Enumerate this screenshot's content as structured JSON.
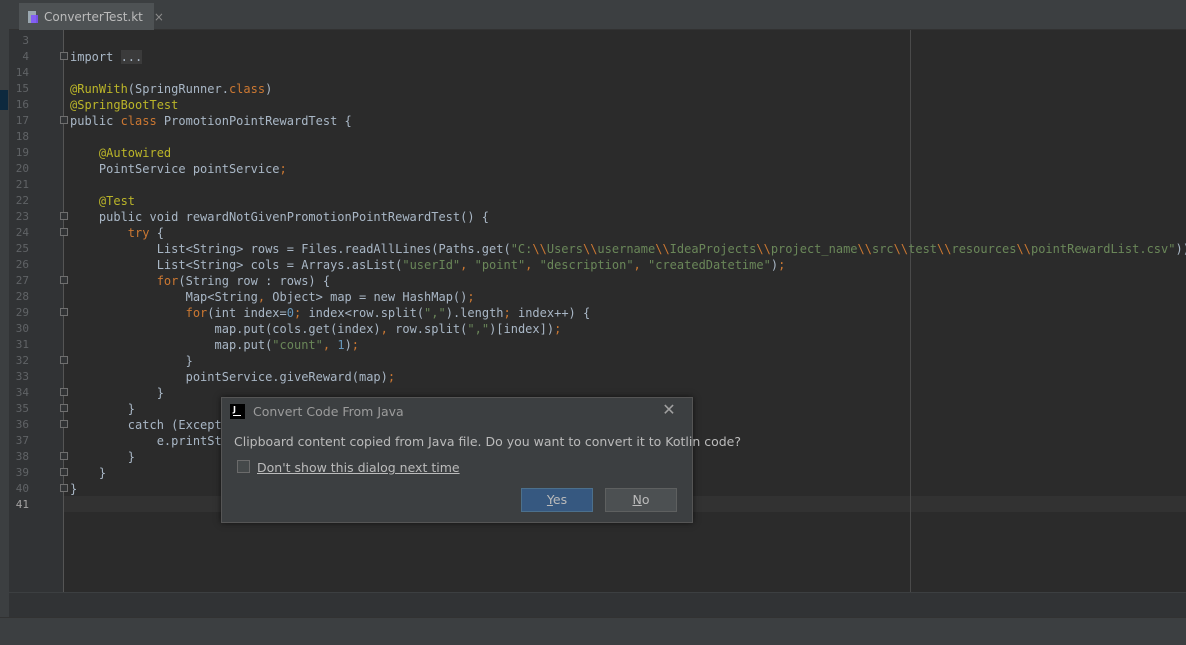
{
  "tab": {
    "filename": "ConverterTest.kt",
    "close": "×"
  },
  "editor": {
    "lines": [
      {
        "n": "3",
        "fold": false,
        "segs": []
      },
      {
        "n": "4",
        "fold": true,
        "segs": [
          [
            "plain",
            "import "
          ],
          [
            "foldbox",
            "..."
          ]
        ]
      },
      {
        "n": "14",
        "fold": false,
        "segs": []
      },
      {
        "n": "15",
        "fold": false,
        "segs": [
          [
            "ann",
            "@RunWith"
          ],
          [
            "plain",
            "(SpringRunner."
          ],
          [
            "kw",
            "class"
          ],
          [
            "plain",
            ")"
          ]
        ]
      },
      {
        "n": "16",
        "fold": false,
        "segs": [
          [
            "ann",
            "@SpringBootTest"
          ]
        ]
      },
      {
        "n": "17",
        "fold": true,
        "segs": [
          [
            "plain",
            "public "
          ],
          [
            "kw",
            "class"
          ],
          [
            "plain",
            " PromotionPointRewardTest {"
          ]
        ]
      },
      {
        "n": "18",
        "fold": false,
        "segs": []
      },
      {
        "n": "19",
        "fold": false,
        "segs": [
          [
            "plain",
            "    "
          ],
          [
            "ann",
            "@Autowired"
          ]
        ]
      },
      {
        "n": "20",
        "fold": false,
        "segs": [
          [
            "plain",
            "    PointService pointService"
          ],
          [
            "kw",
            ";"
          ]
        ]
      },
      {
        "n": "21",
        "fold": false,
        "segs": []
      },
      {
        "n": "22",
        "fold": false,
        "segs": [
          [
            "plain",
            "    "
          ],
          [
            "ann",
            "@Test"
          ]
        ]
      },
      {
        "n": "23",
        "fold": true,
        "segs": [
          [
            "plain",
            "    public void rewardNotGivenPromotionPointRewardTest() {"
          ]
        ]
      },
      {
        "n": "24",
        "fold": true,
        "segs": [
          [
            "plain",
            "        "
          ],
          [
            "kw",
            "try"
          ],
          [
            "plain",
            " {"
          ]
        ]
      },
      {
        "n": "25",
        "fold": false,
        "segs": [
          [
            "plain",
            "            List<String> rows = Files.readAllLines(Paths.get("
          ],
          [
            "str",
            "\"C:"
          ],
          [
            "esc",
            "\\\\"
          ],
          [
            "str",
            "Users"
          ],
          [
            "esc",
            "\\\\"
          ],
          [
            "str",
            "username"
          ],
          [
            "esc",
            "\\\\"
          ],
          [
            "str",
            "IdeaProjects"
          ],
          [
            "esc",
            "\\\\"
          ],
          [
            "str",
            "project_name"
          ],
          [
            "esc",
            "\\\\"
          ],
          [
            "str",
            "src"
          ],
          [
            "esc",
            "\\\\"
          ],
          [
            "str",
            "test"
          ],
          [
            "esc",
            "\\\\"
          ],
          [
            "str",
            "resources"
          ],
          [
            "esc",
            "\\\\"
          ],
          [
            "str",
            "pointRewardList.csv\""
          ],
          [
            "plain",
            "))"
          ],
          [
            "kw",
            ";"
          ]
        ]
      },
      {
        "n": "26",
        "fold": false,
        "segs": [
          [
            "plain",
            "            List<String> cols = Arrays.asList("
          ],
          [
            "str",
            "\"userId\""
          ],
          [
            "kw",
            ", "
          ],
          [
            "str",
            "\"point\""
          ],
          [
            "kw",
            ", "
          ],
          [
            "str",
            "\"description\""
          ],
          [
            "kw",
            ", "
          ],
          [
            "str",
            "\"createdDatetime\""
          ],
          [
            "plain",
            ")"
          ],
          [
            "kw",
            ";"
          ]
        ]
      },
      {
        "n": "27",
        "fold": true,
        "segs": [
          [
            "plain",
            "            "
          ],
          [
            "kw",
            "for"
          ],
          [
            "plain",
            "(String row : rows) {"
          ]
        ]
      },
      {
        "n": "28",
        "fold": false,
        "segs": [
          [
            "plain",
            "                Map<String"
          ],
          [
            "kw",
            ", "
          ],
          [
            "plain",
            "Object> map = new HashMap()"
          ],
          [
            "kw",
            ";"
          ]
        ]
      },
      {
        "n": "29",
        "fold": true,
        "segs": [
          [
            "plain",
            "                "
          ],
          [
            "kw",
            "for"
          ],
          [
            "plain",
            "(int index="
          ],
          [
            "num",
            "0"
          ],
          [
            "kw",
            "; "
          ],
          [
            "plain",
            "index<row.split("
          ],
          [
            "str",
            "\",\""
          ],
          [
            "plain",
            ").length"
          ],
          [
            "kw",
            "; "
          ],
          [
            "plain",
            "index++) {"
          ]
        ]
      },
      {
        "n": "30",
        "fold": false,
        "segs": [
          [
            "plain",
            "                    map.put(cols.get(index)"
          ],
          [
            "kw",
            ", "
          ],
          [
            "plain",
            "row.split("
          ],
          [
            "str",
            "\",\""
          ],
          [
            "plain",
            ")[index])"
          ],
          [
            "kw",
            ";"
          ]
        ]
      },
      {
        "n": "31",
        "fold": false,
        "segs": [
          [
            "plain",
            "                    map.put("
          ],
          [
            "str",
            "\"count\""
          ],
          [
            "kw",
            ", "
          ],
          [
            "num",
            "1"
          ],
          [
            "plain",
            ")"
          ],
          [
            "kw",
            ";"
          ]
        ]
      },
      {
        "n": "32",
        "fold": true,
        "segs": [
          [
            "plain",
            "                }"
          ]
        ]
      },
      {
        "n": "33",
        "fold": false,
        "segs": [
          [
            "plain",
            "                pointService.giveReward(map)"
          ],
          [
            "kw",
            ";"
          ]
        ]
      },
      {
        "n": "34",
        "fold": true,
        "segs": [
          [
            "plain",
            "            }"
          ]
        ]
      },
      {
        "n": "35",
        "fold": true,
        "segs": [
          [
            "plain",
            "        }"
          ]
        ]
      },
      {
        "n": "36",
        "fold": true,
        "segs": [
          [
            "plain",
            "        catch (Excepti"
          ]
        ]
      },
      {
        "n": "37",
        "fold": false,
        "segs": [
          [
            "plain",
            "            e.printSta"
          ]
        ]
      },
      {
        "n": "38",
        "fold": true,
        "segs": [
          [
            "plain",
            "        }"
          ]
        ]
      },
      {
        "n": "39",
        "fold": true,
        "segs": [
          [
            "plain",
            "    }"
          ]
        ]
      },
      {
        "n": "40",
        "fold": true,
        "segs": [
          [
            "plain",
            "}"
          ]
        ]
      },
      {
        "n": "41",
        "fold": false,
        "current": true,
        "segs": []
      }
    ]
  },
  "dialog": {
    "title": "Convert Code From Java",
    "message": "Clipboard content copied from Java file. Do you want to convert it to Kotlin code?",
    "checkbox_label": "Don't show this dialog next time",
    "checkbox_checked": false,
    "yes_mnemonic": "Y",
    "yes_rest": "es",
    "no_mnemonic": "N",
    "no_rest": "o",
    "close": "✕",
    "logo_letter": "J"
  },
  "colors": {
    "background": "#2b2b2b",
    "keyword": "#cc7832",
    "annotation": "#bbb529",
    "string": "#6a8759",
    "number": "#6897bb",
    "default_button": "#365880"
  }
}
